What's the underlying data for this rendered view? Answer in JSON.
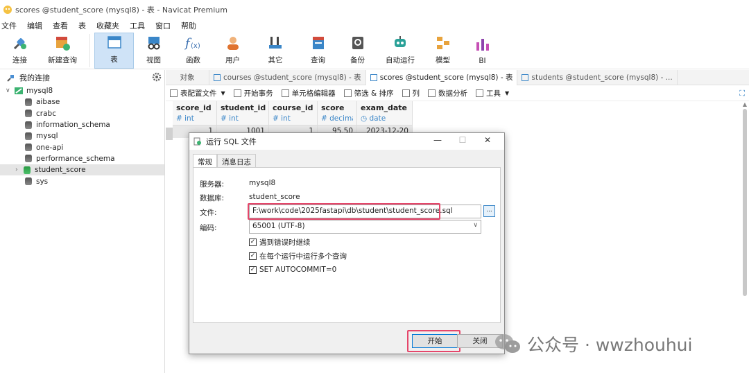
{
  "window": {
    "title": "scores @student_score (mysql8) - 表 - Navicat Premium"
  },
  "menu": [
    "文件",
    "编辑",
    "查看",
    "表",
    "收藏夹",
    "工具",
    "窗口",
    "帮助"
  ],
  "toolbar": {
    "connect": "连接",
    "new_query": "新建查询",
    "table": "表",
    "view": "视图",
    "function": "函数",
    "user": "用户",
    "other": "其它",
    "query": "查询",
    "backup": "备份",
    "automation": "自动运行",
    "model": "模型",
    "bi": "BI"
  },
  "sidebar": {
    "header": "我的连接",
    "connection": "mysql8",
    "databases": [
      "aibase",
      "crabc",
      "information_schema",
      "mysql",
      "one-api",
      "performance_schema",
      "student_score",
      "sys"
    ]
  },
  "tabs": {
    "objects": "对象",
    "t1": "courses @student_score (mysql8) - 表",
    "t2": "scores @student_score (mysql8) - 表",
    "t3": "students @student_score (mysql8) - ..."
  },
  "subtoolbar": {
    "config_file": "表配置文件",
    "begin_tx": "开始事务",
    "cell_editor": "单元格编辑器",
    "filter_sort": "筛选 & 排序",
    "columns": "列",
    "data_analysis": "数据分析",
    "tools": "工具"
  },
  "grid": {
    "columns": [
      {
        "name": "score_id",
        "type": "int"
      },
      {
        "name": "student_id",
        "type": "int"
      },
      {
        "name": "course_id",
        "type": "int"
      },
      {
        "name": "score",
        "type": "decima"
      },
      {
        "name": "exam_date",
        "type": "date"
      }
    ],
    "row": [
      "1",
      "1001",
      "1",
      "95.50",
      "2023-12-20"
    ]
  },
  "dialog": {
    "title": "运行 SQL 文件",
    "tab_general": "常规",
    "tab_log": "消息日志",
    "server_label": "服务器:",
    "server_value": "mysql8",
    "db_label": "数据库:",
    "db_value": "student_score",
    "file_label": "文件:",
    "file_value": "F:\\work\\code\\2025fastapi\\db\\student\\student_score.sql",
    "browse": "...",
    "encoding_label": "编码:",
    "encoding_value": "65001 (UTF-8)",
    "opt1": "遇到错误时继续",
    "opt2": "在每个运行中运行多个查询",
    "opt3": "SET AUTOCOMMIT=0",
    "start": "开始",
    "close": "关闭",
    "minimize": "—",
    "maximize": "☐",
    "close_x": "✕"
  },
  "watermark": {
    "text": "公众号 · wwzhouhui"
  }
}
